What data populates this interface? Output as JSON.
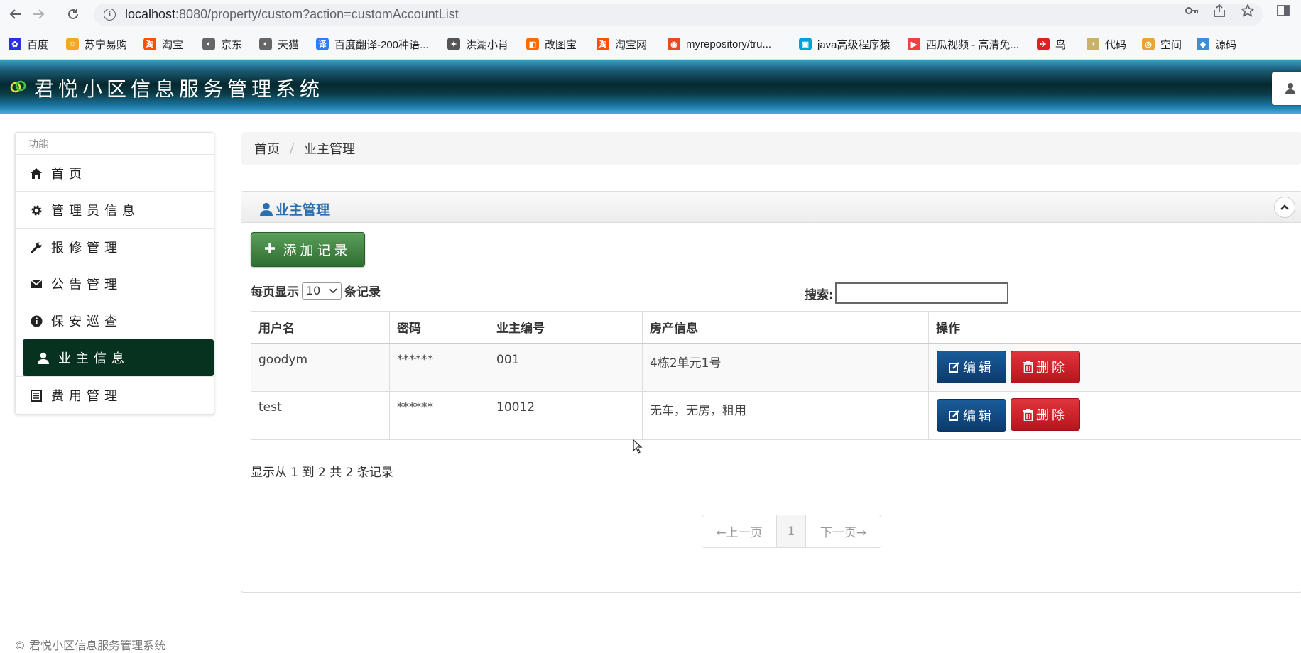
{
  "browser": {
    "url_host": "localhost",
    "url_rest": ":8080/property/custom?action=customAccountList",
    "bookmarks": [
      {
        "label": "百度",
        "color": "#2932e1"
      },
      {
        "label": "苏宁易购",
        "color": "#f5a623"
      },
      {
        "label": "淘宝",
        "color": "#ff5000"
      },
      {
        "label": "京东",
        "color": "#666666"
      },
      {
        "label": "天猫",
        "color": "#666666"
      },
      {
        "label": "百度翻译-200种语...",
        "color": "#2e7cf6"
      },
      {
        "label": "洪湖小肖",
        "color": "#555555"
      },
      {
        "label": "改图宝",
        "color": "#ff6a00"
      },
      {
        "label": "淘宝网",
        "color": "#ff5000"
      },
      {
        "label": "myrepository/tru...",
        "color": "#e34c26"
      },
      {
        "label": "java高级程序猿",
        "color": "#00a1d6"
      },
      {
        "label": "西瓜视频 - 高清免...",
        "color": "#f04142"
      },
      {
        "label": "鸟",
        "color": "#e02020"
      },
      {
        "label": "代码",
        "color": "#c9b26a"
      },
      {
        "label": "空间",
        "color": "#e8a33b"
      },
      {
        "label": "源码",
        "color": "#3a8fd6"
      }
    ]
  },
  "app": {
    "title": "君悦小区信息服务管理系统"
  },
  "sidebar": {
    "heading": "功能",
    "items": [
      {
        "label": "首页",
        "icon": "home-icon"
      },
      {
        "label": "管理员信息",
        "icon": "gear-icon"
      },
      {
        "label": "报修管理",
        "icon": "wrench-icon"
      },
      {
        "label": "公告管理",
        "icon": "envelope-icon"
      },
      {
        "label": "保安巡查",
        "icon": "info-icon"
      },
      {
        "label": "业主信息",
        "icon": "user-icon",
        "active": true
      },
      {
        "label": "费用管理",
        "icon": "list-icon"
      }
    ]
  },
  "breadcrumb": {
    "home": "首页",
    "separator": "/",
    "current": "业主管理"
  },
  "panel": {
    "title": "业主管理",
    "add_button": "添加记录",
    "length_prefix": "每页显示",
    "length_value": "10",
    "length_suffix": "条记录",
    "search_label": "搜索:",
    "columns": [
      "用户名",
      "密码",
      "业主编号",
      "房产信息",
      "操作"
    ],
    "rows": [
      {
        "username": "goodym",
        "password": "******",
        "owner_id": "001",
        "property": "4栋2单元1号"
      },
      {
        "username": "test",
        "password": "******",
        "owner_id": "10012",
        "property": "无车，无房，租用"
      }
    ],
    "edit_label": "编辑",
    "delete_label": "删除",
    "info": "显示从 1 到 2 共 2 条记录",
    "pager": {
      "prev": "←上一页",
      "page": "1",
      "next": "下一页→"
    }
  },
  "footer": {
    "text": "© 君悦小区信息服务管理系统"
  },
  "colors": {
    "sidebar_active": "#07321f",
    "add_button": "#3f8a42",
    "edit_button": "#124b84",
    "delete_button": "#cc2229",
    "panel_title": "#2a6fb0"
  }
}
